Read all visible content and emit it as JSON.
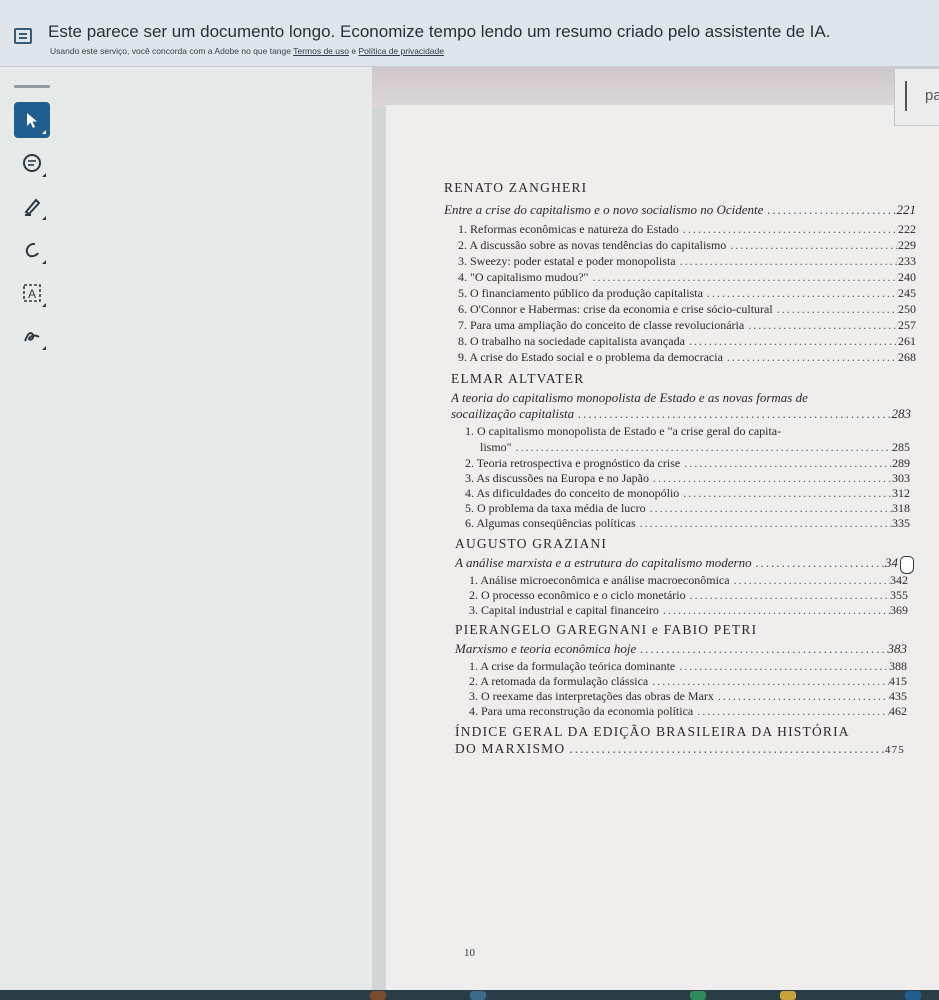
{
  "banner": {
    "title": "Este parece ser um documento longo. Economize tempo lendo um resumo criado pelo assistente de IA.",
    "sub_prefix": "Usando este serviço, você concorda com a Adobe no que tange",
    "terms_link": "Termos de uso",
    "conj": "e",
    "privacy_link": "Política de privacidade"
  },
  "tools": [
    {
      "icon": "select-arrow-icon",
      "active": true
    },
    {
      "icon": "comment-icon",
      "active": false
    },
    {
      "icon": "highlight-pen-icon",
      "active": false
    },
    {
      "icon": "draw-freehand-icon",
      "active": false
    },
    {
      "icon": "text-select-icon",
      "active": false
    },
    {
      "icon": "signature-icon",
      "active": false
    }
  ],
  "side_panel_text": "pa",
  "toc": {
    "sections": [
      {
        "author": "RENATO ZANGHERI",
        "essay": "Entre a crise do capitalismo e o novo socialismo no Ocidente",
        "essay_page": "221",
        "items": [
          {
            "text": "1. Reformas econômicas e natureza do Estado",
            "page": "222"
          },
          {
            "text": "2. A discussão sobre as novas tendências do capitalismo",
            "page": "229"
          },
          {
            "text": "3. Sweezy: poder estatal e poder monopolista",
            "page": "233"
          },
          {
            "text": "4. \"O capitalismo mudou?\"",
            "page": "240"
          },
          {
            "text": "5. O financiamento público da produção capitalista",
            "page": "245"
          },
          {
            "text": "6. O'Connor e Habermas: crise da economia e crise sócio-cultural",
            "page": "250"
          },
          {
            "text": "7. Para uma ampliação do conceito de classe revolucionária",
            "page": "257"
          },
          {
            "text": "8. O trabalho na sociedade capitalista avançada",
            "page": "261"
          },
          {
            "text": "9. A crise do Estado social e o problema da democracia",
            "page": "268"
          }
        ]
      },
      {
        "author": "ELMAR ALTVATER",
        "essay": "A teoria do capitalismo monopolista de Estado e as novas formas de",
        "essay_line2": "socailização capitalista",
        "essay_page": "283",
        "items": [
          {
            "text": "1. O capitalismo monopolista de Estado e \"a crise geral do capita-",
            "page": ""
          },
          {
            "text": "lismo\"",
            "page": "285"
          },
          {
            "text": "2. Teoria retrospectiva e prognóstico da crise",
            "page": "289"
          },
          {
            "text": "3. As discussões na Europa e no Japão",
            "page": "303"
          },
          {
            "text": "4. As dificuldades do conceito de monopólio",
            "page": "312"
          },
          {
            "text": "5. O problema da taxa média de lucro",
            "page": "318"
          },
          {
            "text": "6. Algumas conseqüências políticas",
            "page": "335"
          }
        ]
      },
      {
        "author": "AUGUSTO GRAZIANI",
        "essay": "A análise marxista e a estrutura do capitalismo moderno",
        "essay_page": "34",
        "items": [
          {
            "text": "1. Análise microeconômica e análise macroeconômica",
            "page": "342"
          },
          {
            "text": "2. O processo econômico e o ciclo monetário",
            "page": "355"
          },
          {
            "text": "3. Capital industrial e capital financeiro",
            "page": "369"
          }
        ]
      },
      {
        "author": "PIERANGELO GAREGNANI e FABIO PETRI",
        "essay": "Marxismo e teoria econômica hoje",
        "essay_page": "383",
        "items": [
          {
            "text": "1. A crise da formulação teórica dominante",
            "page": "388"
          },
          {
            "text": "2. A retomada da formulação clássica",
            "page": "415"
          },
          {
            "text": "3. O reexame das interpretações das obras de Marx",
            "page": "435"
          },
          {
            "text": "4. Para uma reconstrução da economia política",
            "page": "462"
          }
        ]
      }
    ],
    "index_title_line1": "ÍNDICE GERAL DA EDIÇÃO BRASILEIRA DA HISTÓRIA",
    "index_title_line2": "DO MARXISMO",
    "index_page": "475",
    "page_number": "10"
  }
}
